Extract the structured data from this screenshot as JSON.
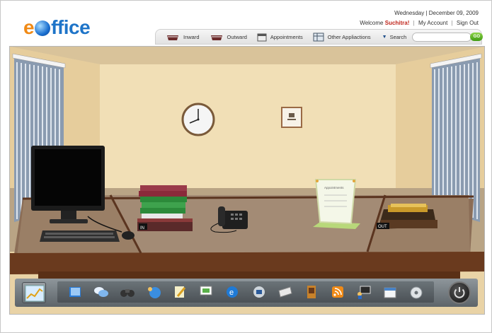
{
  "app": {
    "logo_e": "e",
    "logo_rest_before": "",
    "logo_rest": "ffice"
  },
  "header": {
    "date": "Wednesday | December 09, 2009",
    "welcome_prefix": "Welcome",
    "user": "Suchitra!",
    "my_account": "My Account",
    "sign_out": "Sign Out"
  },
  "nav": {
    "items": [
      {
        "label": "Inward",
        "icon": "inward-tray-icon"
      },
      {
        "label": "Outward",
        "icon": "outward-tray-icon"
      },
      {
        "label": "Appointments",
        "icon": "calendar-icon"
      },
      {
        "label": "Other Appliactions",
        "icon": "apps-grid-icon"
      }
    ],
    "search_label": "Search",
    "search_placeholder": "",
    "go_label": "GO"
  },
  "scene": {
    "inbox_tag": "IN",
    "outbox_tag": "OUT",
    "card_title": "Appointments"
  },
  "dock": {
    "icons": [
      "book-icon",
      "chat-bubbles-icon",
      "binoculars-icon",
      "people-globe-icon",
      "notepad-pencil-icon",
      "presentation-board-icon",
      "ie-browser-icon",
      "mail-stamp-icon",
      "newspaper-icon",
      "book-library-icon",
      "rss-icon",
      "notice-board-icon",
      "calendar-icon",
      "settings-disc-icon"
    ]
  },
  "colors": {
    "brand_blue": "#1e74c8",
    "brand_orange": "#f08a16",
    "user_red": "#c0271d",
    "go_green": "#5cb11f"
  }
}
